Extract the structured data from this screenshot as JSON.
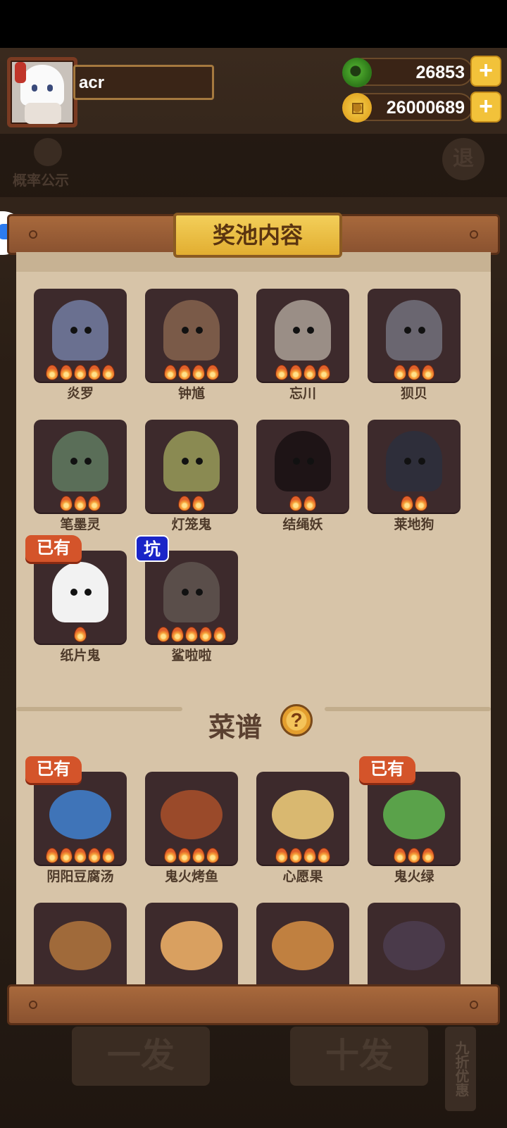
{
  "player": {
    "name": "acr"
  },
  "currency": {
    "jade": "26853",
    "coins": "26000689"
  },
  "background": {
    "prob_label": "概率公示",
    "exit_label": "退",
    "single_draw": "一发",
    "ten_draw": "十发",
    "discount": "九折优惠"
  },
  "panel": {
    "title": "奖池内容"
  },
  "badges": {
    "owned": "已有",
    "pit": "坑"
  },
  "characters": [
    {
      "name": "炎罗",
      "stars": 5,
      "owned": false,
      "pit": false,
      "color": "#6a7090"
    },
    {
      "name": "钟馗",
      "stars": 4,
      "owned": false,
      "pit": false,
      "color": "#7a5a48"
    },
    {
      "name": "忘川",
      "stars": 4,
      "owned": false,
      "pit": false,
      "color": "#9a8e86"
    },
    {
      "name": "狈贝",
      "stars": 3,
      "owned": false,
      "pit": false,
      "color": "#6a6670"
    },
    {
      "name": "笔墨灵",
      "stars": 3,
      "owned": false,
      "pit": false,
      "color": "#5a6e58"
    },
    {
      "name": "灯笼鬼",
      "stars": 2,
      "owned": false,
      "pit": false,
      "color": "#8a8a52"
    },
    {
      "name": "结绳妖",
      "stars": 2,
      "owned": false,
      "pit": false,
      "color": "#1e1416"
    },
    {
      "name": "莱地狗",
      "stars": 2,
      "owned": false,
      "pit": false,
      "color": "#2e2e3a"
    },
    {
      "name": "纸片鬼",
      "stars": 1,
      "owned": true,
      "pit": false,
      "color": "#f2f2f2"
    },
    {
      "name": "鲨啦啦",
      "stars": 5,
      "owned": false,
      "pit": true,
      "color": "#5a4e4a"
    }
  ],
  "recipes_section": {
    "title": "菜谱",
    "help": "?"
  },
  "recipes": [
    {
      "name": "阴阳豆腐汤",
      "stars": 5,
      "owned": true,
      "color": "#3f74b8"
    },
    {
      "name": "鬼火烤鱼",
      "stars": 4,
      "owned": false,
      "color": "#9a4a2a"
    },
    {
      "name": "心愿果",
      "stars": 4,
      "owned": false,
      "color": "#d9b870"
    },
    {
      "name": "鬼火绿",
      "stars": 3,
      "owned": true,
      "color": "#5aa24a"
    },
    {
      "name": "",
      "stars": 0,
      "owned": false,
      "color": "#a06a3a"
    },
    {
      "name": "",
      "stars": 0,
      "owned": false,
      "color": "#d9a060"
    },
    {
      "name": "",
      "stars": 0,
      "owned": false,
      "color": "#c08040"
    },
    {
      "name": "",
      "stars": 0,
      "owned": false,
      "color": "#4a3a4a"
    }
  ]
}
